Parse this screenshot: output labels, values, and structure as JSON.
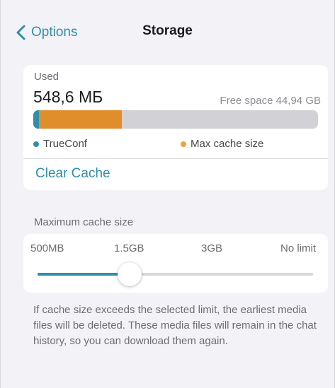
{
  "nav": {
    "back_label": "Options",
    "title": "Storage"
  },
  "usage": {
    "caption": "Used",
    "used_value": "548,6 МБ",
    "free_space": "Free space 44,94 GB",
    "bar": {
      "app_fraction": 0.02,
      "cache_fraction": 0.29
    },
    "legend": [
      {
        "label": "TrueConf",
        "color": "#2f8fa8"
      },
      {
        "label": "Max cache size",
        "color": "#f0a23b"
      }
    ],
    "clear_cache_label": "Clear Cache"
  },
  "cache_limit": {
    "caption": "Maximum cache size",
    "options": [
      "500MB",
      "1.5GB",
      "3GB",
      "No limit"
    ],
    "selected": "1.5GB",
    "footnote": "If cache size exceeds the selected limit, the earliest media files will be deleted. These media files will remain in the chat history, so you can download them again."
  },
  "colors": {
    "accent": "#2f8fa8",
    "cache": "#e08e2c",
    "track": "#d1d1d6",
    "background": "#f2f2f7"
  }
}
